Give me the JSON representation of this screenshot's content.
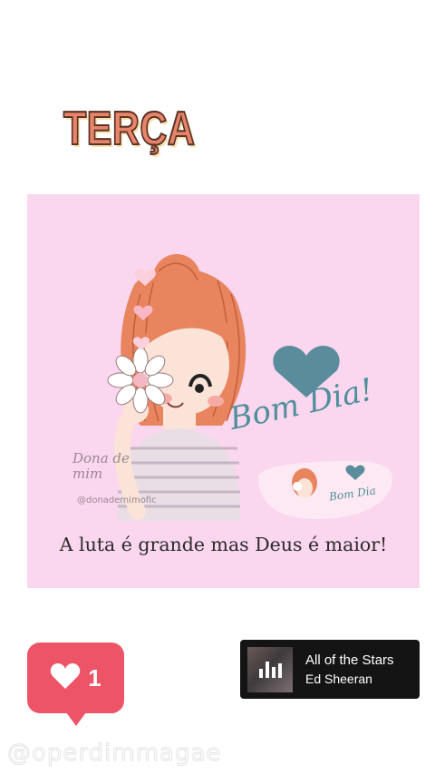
{
  "story": {
    "title": "TERÇA"
  },
  "post": {
    "greeting": "Bom Dia!",
    "mini_greeting": "Bom Dia",
    "watermark_name": "Dona de mim",
    "watermark_handle": "@donademimofic",
    "caption": "A luta é grande mas Deus é maior!",
    "background_color": "#fbd6ef"
  },
  "like_sticker": {
    "icon": "heart-icon",
    "count": "1",
    "color": "#ee5467"
  },
  "music_sticker": {
    "song_title": "All of the Stars",
    "artist": "Ed Sheeran",
    "icon": "equalizer-icon"
  },
  "footer": {
    "username": "@operdimmagae"
  }
}
